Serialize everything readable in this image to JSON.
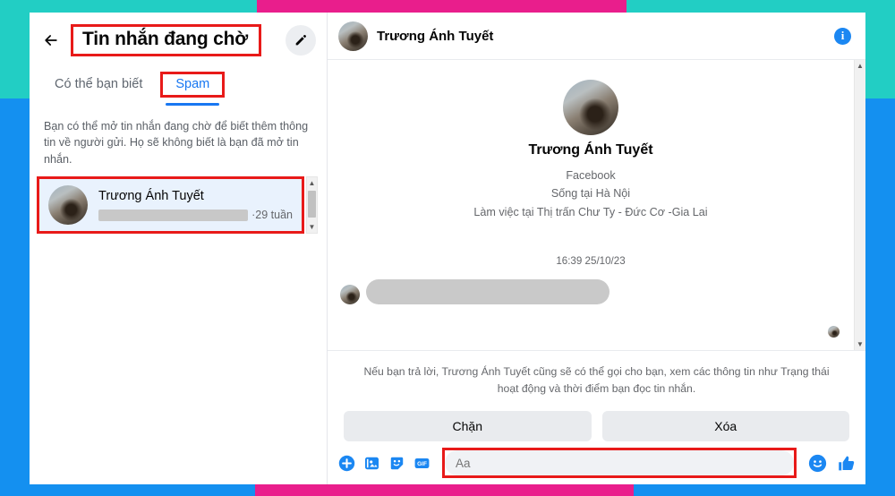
{
  "colors": {
    "strip_teal": "#22cec4",
    "strip_pink": "#e91e8c",
    "strip_blue": "#1490f0",
    "highlight_red": "#e81a19",
    "accent_blue": "#1877f2",
    "selected_row": "#e9f2fd"
  },
  "left_panel": {
    "back_icon": "arrow-left-icon",
    "title": "Tin nhắn đang chờ",
    "compose_icon": "pencil-icon",
    "tabs": [
      {
        "label": "Có thể bạn biết",
        "active": false
      },
      {
        "label": "Spam",
        "active": true
      }
    ],
    "note": "Bạn có thể mở tin nhắn đang chờ để biết thêm thông tin về người gửi. Họ sẽ không biết là bạn đã mở tin nhắn.",
    "conversations": [
      {
        "name": "Trương Ánh Tuyết",
        "preview": "",
        "time": "·29 tuần",
        "selected": true
      }
    ],
    "scrollbar": {
      "up_icon": "caret-up-icon",
      "down_icon": "caret-down-icon"
    }
  },
  "right_panel": {
    "header": {
      "name": "Trương Ánh Tuyết",
      "info_icon": "info-icon",
      "info_glyph": "i"
    },
    "profile": {
      "name": "Trương Ánh Tuyết",
      "lines": [
        "Facebook",
        "Sống tại Hà Nội",
        "Làm việc tại Thị trấn Chư Ty - Đức Cơ -Gia Lai"
      ]
    },
    "thread": {
      "timestamp": "16:39 25/10/23",
      "message_redacted": true
    },
    "notice": "Nếu bạn trả lời, Trương Ánh Tuyết cũng sẽ có thể gọi cho bạn, xem các thông tin như Trạng thái hoạt động và thời điểm bạn đọc tin nhắn.",
    "actions": [
      {
        "label": "Chặn",
        "name": "block-button"
      },
      {
        "label": "Xóa",
        "name": "delete-button"
      }
    ],
    "composer": {
      "icons": [
        "plus-circle-icon",
        "photo-icon",
        "sticker-icon",
        "gif-icon"
      ],
      "gif_label": "GIF",
      "input_value": "",
      "input_placeholder": "Aa",
      "emoji_icon": "emoji-smiley-icon",
      "like_icon": "thumbs-up-icon"
    }
  }
}
